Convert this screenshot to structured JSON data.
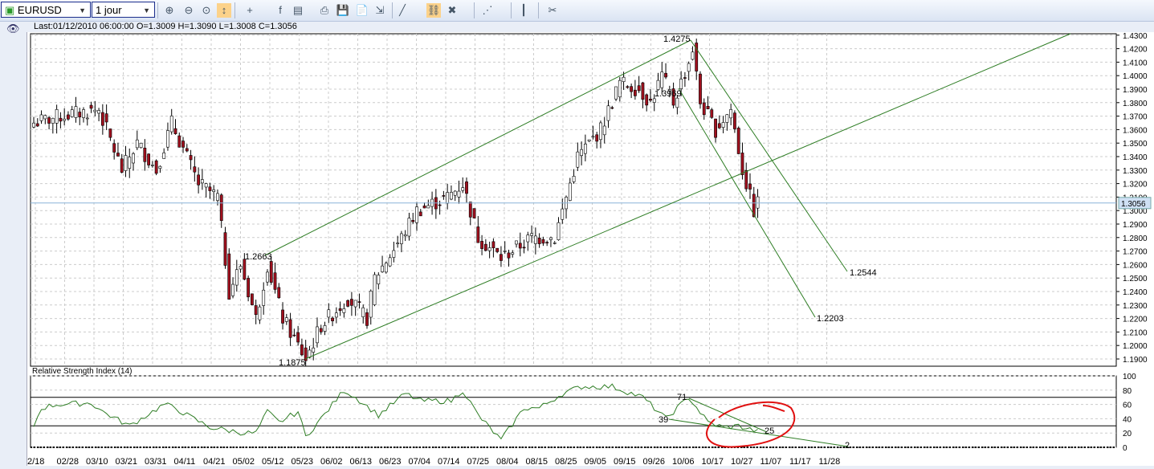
{
  "toolbar": {
    "symbol": "EURUSD",
    "timeframe": "1 jour",
    "icons": [
      "zoom-in-icon",
      "zoom-out-icon",
      "zoom-fit-icon",
      "autoscale-icon",
      "crosshair-icon",
      "function-icon",
      "template-icon",
      "print-icon",
      "save-icon",
      "document-icon",
      "export-icon",
      "line-tool-icon",
      "link-icon",
      "delete-objects-icon",
      "indicator-icon",
      "candle-type-icon",
      "settings-icon"
    ]
  },
  "info": "Last:01/12/2010 06:00:00 O=1.3009 H=1.3090 L=1.3008 C=1.3056",
  "rsi_title": "Relative Strength Index (14)",
  "chart_data": {
    "type": "candlestick",
    "symbol": "EURUSD",
    "price_axis": [
      "1.4300",
      "1.4200",
      "1.4100",
      "1.4000",
      "1.3900",
      "1.3800",
      "1.3700",
      "1.3600",
      "1.3500",
      "1.3400",
      "1.3300",
      "1.3200",
      "1.3100",
      "1.3000",
      "1.2900",
      "1.2800",
      "1.2700",
      "1.2600",
      "1.2500",
      "1.2400",
      "1.2300",
      "1.2200",
      "1.2100",
      "1.2000",
      "1.1900"
    ],
    "ylim": [
      1.185,
      1.432
    ],
    "last_price": "1.3056",
    "date_ticks": [
      "2/18",
      "02/28",
      "03/10",
      "03/21",
      "03/31",
      "04/11",
      "04/21",
      "05/02",
      "05/12",
      "05/23",
      "06/02",
      "06/13",
      "06/23",
      "07/04",
      "07/14",
      "07/25",
      "08/04",
      "08/15",
      "08/25",
      "09/05",
      "09/15",
      "09/26",
      "10/06",
      "10/17",
      "10/27",
      "11/07",
      "11/17",
      "11/28"
    ],
    "close_anchors": [
      [
        0,
        1.365
      ],
      [
        7,
        1.37
      ],
      [
        17,
        1.375
      ],
      [
        23,
        1.33
      ],
      [
        27,
        1.35
      ],
      [
        32,
        1.33
      ],
      [
        36,
        1.365
      ],
      [
        43,
        1.32
      ],
      [
        48,
        1.31
      ],
      [
        51,
        1.24
      ],
      [
        54,
        1.26
      ],
      [
        58,
        1.22
      ],
      [
        61,
        1.26
      ],
      [
        65,
        1.22
      ],
      [
        71,
        1.19
      ],
      [
        75,
        1.215
      ],
      [
        82,
        1.235
      ],
      [
        87,
        1.22
      ],
      [
        89,
        1.25
      ],
      [
        96,
        1.28
      ],
      [
        100,
        1.3
      ],
      [
        108,
        1.31
      ],
      [
        112,
        1.32
      ],
      [
        116,
        1.28
      ],
      [
        122,
        1.265
      ],
      [
        130,
        1.28
      ],
      [
        136,
        1.28
      ],
      [
        139,
        1.31
      ],
      [
        142,
        1.34
      ],
      [
        148,
        1.36
      ],
      [
        153,
        1.395
      ],
      [
        158,
        1.39
      ],
      [
        161,
        1.38
      ],
      [
        164,
        1.4
      ],
      [
        167,
        1.38
      ],
      [
        171,
        1.41
      ],
      [
        172,
        1.42
      ],
      [
        174,
        1.38
      ],
      [
        178,
        1.36
      ],
      [
        182,
        1.375
      ],
      [
        185,
        1.33
      ],
      [
        188,
        1.3
      ],
      [
        189,
        1.3056
      ]
    ],
    "annotations": [
      "1.4275",
      "1.3969",
      "1.2663",
      "1.1875",
      "1.2544",
      "1.2203"
    ],
    "rsi": {
      "axis": [
        "100",
        "80",
        "60",
        "40",
        "20",
        "0"
      ],
      "levels": [
        70,
        30
      ],
      "labels": [
        "71",
        "39",
        "25",
        "2"
      ],
      "anchors": [
        [
          0,
          30
        ],
        [
          2,
          55
        ],
        [
          6,
          60
        ],
        [
          15,
          62
        ],
        [
          18,
          50
        ],
        [
          25,
          30
        ],
        [
          34,
          60
        ],
        [
          37,
          55
        ],
        [
          40,
          45
        ],
        [
          46,
          28
        ],
        [
          55,
          20
        ],
        [
          58,
          20
        ],
        [
          61,
          50
        ],
        [
          64,
          35
        ],
        [
          69,
          50
        ],
        [
          71,
          15
        ],
        [
          75,
          40
        ],
        [
          81,
          80
        ],
        [
          84,
          70
        ],
        [
          90,
          45
        ],
        [
          97,
          75
        ],
        [
          101,
          65
        ],
        [
          109,
          65
        ],
        [
          112,
          80
        ],
        [
          116,
          45
        ],
        [
          122,
          10
        ],
        [
          128,
          55
        ],
        [
          132,
          55
        ],
        [
          138,
          75
        ],
        [
          143,
          85
        ],
        [
          151,
          85
        ],
        [
          159,
          70
        ],
        [
          165,
          40
        ],
        [
          171,
          70
        ],
        [
          176,
          35
        ],
        [
          180,
          28
        ],
        [
          184,
          30
        ],
        [
          189,
          22
        ]
      ]
    }
  }
}
